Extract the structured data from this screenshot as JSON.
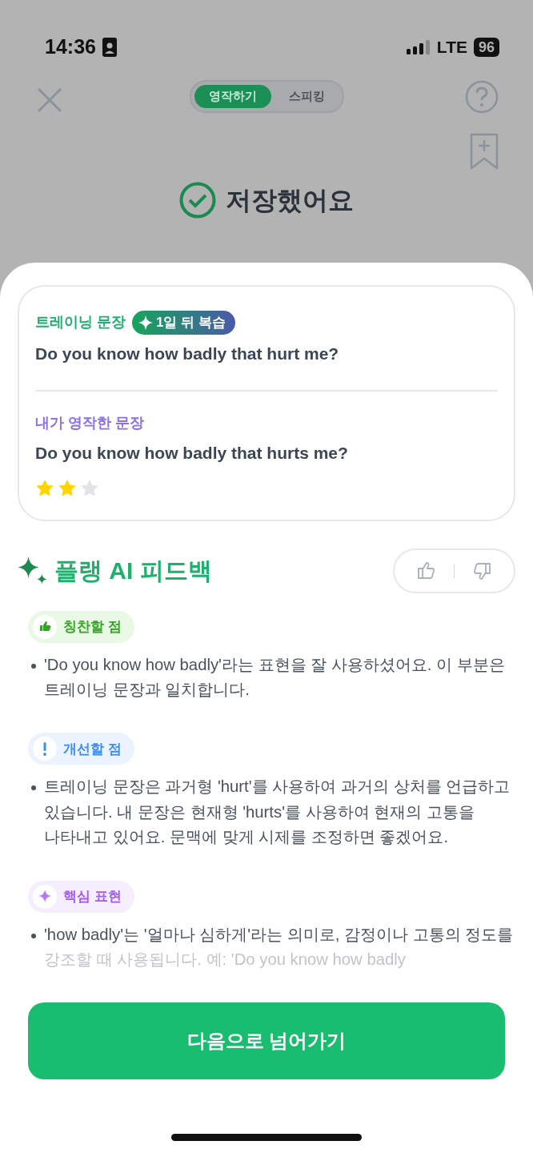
{
  "status_bar": {
    "time": "14:36",
    "network": "LTE",
    "battery": "96"
  },
  "header": {
    "tabs": [
      {
        "label": "영작하기",
        "selected": true
      },
      {
        "label": "스피킹",
        "selected": false
      }
    ],
    "title": "저장했어요"
  },
  "card": {
    "training": {
      "label": "트레이닝 문장",
      "badge": "1일 뒤 복습",
      "sentence": "Do you know how badly that hurt me?"
    },
    "mine": {
      "label": "내가 영작한 문장",
      "sentence": "Do you know how badly that hurts me?",
      "stars": 2
    }
  },
  "feedback": {
    "title": "플랭 AI 피드백",
    "sections": [
      {
        "kind": "praise",
        "label": "칭찬할 점",
        "bullets": [
          "'Do you know how badly'라는 표현을 잘 사용하셨어요. 이 부분은 트레이닝 문장과 일치합니다."
        ]
      },
      {
        "kind": "improve",
        "label": "개선할 점",
        "bullets": [
          "트레이닝 문장은 과거형 'hurt'를 사용하여 과거의 상처를 언급하고 있습니다. 내 문장은 현재형 'hurts'를 사용하여 현재의 고통을 나타내고 있어요. 문맥에 맞게 시제를 조정하면 좋겠어요."
        ]
      },
      {
        "kind": "key",
        "label": "핵심 표현",
        "bullets": [
          "'how badly'는 '얼마나 심하게'라는 의미로, 감정이나 고통의 정도를 강조할 때 사용됩니다. 예: 'Do you know how badly"
        ]
      }
    ]
  },
  "next_button": "다음으로 넘어가기"
}
